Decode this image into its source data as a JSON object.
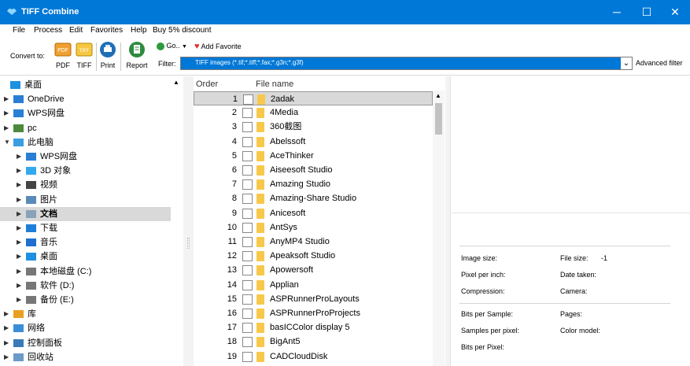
{
  "window": {
    "title": "TIFF Combine",
    "controls": {
      "minimize": "─",
      "maximize": "☐",
      "close": "✕"
    }
  },
  "menu": [
    "File",
    "Process",
    "Edit",
    "Favorites",
    "Help",
    "Buy 5% discount"
  ],
  "toolbar": {
    "convert_to": "Convert to:",
    "buttons": {
      "pdf": "PDF",
      "tiff": "TIFF",
      "print": "Print",
      "report": "Report"
    },
    "icon_text": {
      "pdf": "PDF",
      "tiff": "TIFF"
    },
    "go": "Go..",
    "add_favorite": "Add Favorite",
    "filter_label": "Filter:",
    "filter_value": "TIFF images (*.tif;*.tiff;*.fax;*.g3n;*.g3f)",
    "advanced_filter": "Advanced filter"
  },
  "tree": [
    {
      "label": "桌面",
      "icon": "desktop-icon",
      "arrow": ""
    },
    {
      "label": "OneDrive",
      "icon": "cloud-icon",
      "arrow": "▶"
    },
    {
      "label": "WPS网盘",
      "icon": "cloud-icon",
      "arrow": "▶"
    },
    {
      "label": "pc",
      "icon": "user-icon",
      "arrow": "▶"
    },
    {
      "label": "此电脑",
      "icon": "computer-icon",
      "arrow": "▼"
    },
    {
      "label": "WPS网盘",
      "icon": "cloud-icon",
      "arrow": "▶"
    },
    {
      "label": "3D 对象",
      "icon": "cube-icon",
      "arrow": "▶"
    },
    {
      "label": "视频",
      "icon": "video-icon",
      "arrow": "▶"
    },
    {
      "label": "图片",
      "icon": "picture-icon",
      "arrow": "▶"
    },
    {
      "label": "文档",
      "icon": "document-icon",
      "arrow": "▶"
    },
    {
      "label": "下载",
      "icon": "download-icon",
      "arrow": "▶"
    },
    {
      "label": "音乐",
      "icon": "music-icon",
      "arrow": "▶"
    },
    {
      "label": "桌面",
      "icon": "desktop-icon",
      "arrow": "▶"
    },
    {
      "label": "本地磁盘 (C:)",
      "icon": "drive-icon",
      "arrow": "▶"
    },
    {
      "label": "软件 (D:)",
      "icon": "drive-icon",
      "arrow": "▶"
    },
    {
      "label": "备份 (E:)",
      "icon": "drive-icon",
      "arrow": "▶"
    },
    {
      "label": "库",
      "icon": "library-icon",
      "arrow": "▶"
    },
    {
      "label": "网络",
      "icon": "network-icon",
      "arrow": "▶"
    },
    {
      "label": "控制面板",
      "icon": "control-panel-icon",
      "arrow": "▶"
    },
    {
      "label": "回收站",
      "icon": "recycle-bin-icon",
      "arrow": "▶"
    }
  ],
  "tree_scroll_up": "▲",
  "filelist": {
    "headers": {
      "order": "Order",
      "name": "File name"
    },
    "rows": [
      {
        "order": "1",
        "name": "2adak"
      },
      {
        "order": "2",
        "name": "4Media"
      },
      {
        "order": "3",
        "name": "360截图"
      },
      {
        "order": "4",
        "name": "Abelssoft"
      },
      {
        "order": "5",
        "name": "AceThinker"
      },
      {
        "order": "6",
        "name": "Aiseesoft Studio"
      },
      {
        "order": "7",
        "name": "Amazing Studio"
      },
      {
        "order": "8",
        "name": "Amazing-Share Studio"
      },
      {
        "order": "9",
        "name": "Anicesoft"
      },
      {
        "order": "10",
        "name": "AntSys"
      },
      {
        "order": "11",
        "name": "AnyMP4 Studio"
      },
      {
        "order": "12",
        "name": "Apeaksoft Studio"
      },
      {
        "order": "13",
        "name": "Apowersoft"
      },
      {
        "order": "14",
        "name": "Applian"
      },
      {
        "order": "15",
        "name": "ASPRunnerProLayouts"
      },
      {
        "order": "16",
        "name": "ASPRunnerProProjects"
      },
      {
        "order": "17",
        "name": "basICColor display 5"
      },
      {
        "order": "18",
        "name": "BigAnt5"
      },
      {
        "order": "19",
        "name": "CADCloudDisk"
      }
    ],
    "scroll_up": "▲"
  },
  "info": {
    "image_size": "Image size:",
    "file_size": "File size:",
    "file_size_value": "-1",
    "pixel_per_inch": "Pixel per inch:",
    "date_taken": "Date taken:",
    "compression": "Compression:",
    "camera": "Camera:",
    "bits_per_sample": "Bits per Sample:",
    "pages": "Pages:",
    "samples_per_pixel": "Samples per pixel:",
    "color_model": "Color model:",
    "bits_per_pixel": "Bits per Pixel:"
  },
  "colors": {
    "accent": "#0078d7",
    "selection": "#d9d9d9",
    "folder": "#f7c84a"
  }
}
